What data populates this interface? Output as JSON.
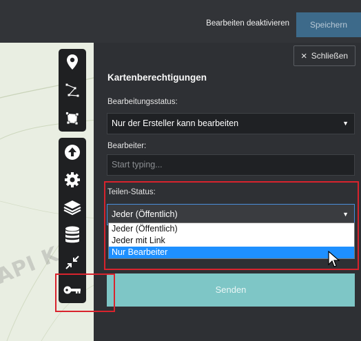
{
  "topbar": {
    "disable_edit_label": "Bearbeiten deaktivieren",
    "save_label": "Speichern"
  },
  "map": {
    "watermark_text": "API Ke"
  },
  "toolbar_primary": [
    {
      "icon": "map-marker-icon"
    },
    {
      "icon": "polyline-icon"
    },
    {
      "icon": "polygon-icon"
    }
  ],
  "toolbar_secondary": [
    {
      "icon": "upload-icon"
    },
    {
      "icon": "gear-icon"
    },
    {
      "icon": "layers-icon"
    },
    {
      "icon": "database-icon"
    },
    {
      "icon": "collapse-arrows-icon"
    },
    {
      "icon": "key-icon"
    }
  ],
  "panel": {
    "close_label": "Schließen",
    "title": "Kartenberechtigungen",
    "edit_status": {
      "label": "Bearbeitungsstatus:",
      "value": "Nur der Ersteller kann bearbeiten"
    },
    "editors": {
      "label": "Bearbeiter:",
      "placeholder": "Start typing..."
    },
    "share_status": {
      "label": "Teilen-Status:",
      "value": "Jeder (Öffentlich)",
      "options": [
        "Jeder (Öffentlich)",
        "Jeder mit Link",
        "Nur Bearbeiter"
      ],
      "highlighted_option": "Nur Bearbeiter"
    },
    "send_label": "Senden"
  },
  "colors": {
    "panel_bg": "#2e3034",
    "send_button": "#7ec6c6",
    "save_button": "#3d6a8a",
    "highlight_red": "#d9232d",
    "option_selected": "#1e90ff"
  }
}
